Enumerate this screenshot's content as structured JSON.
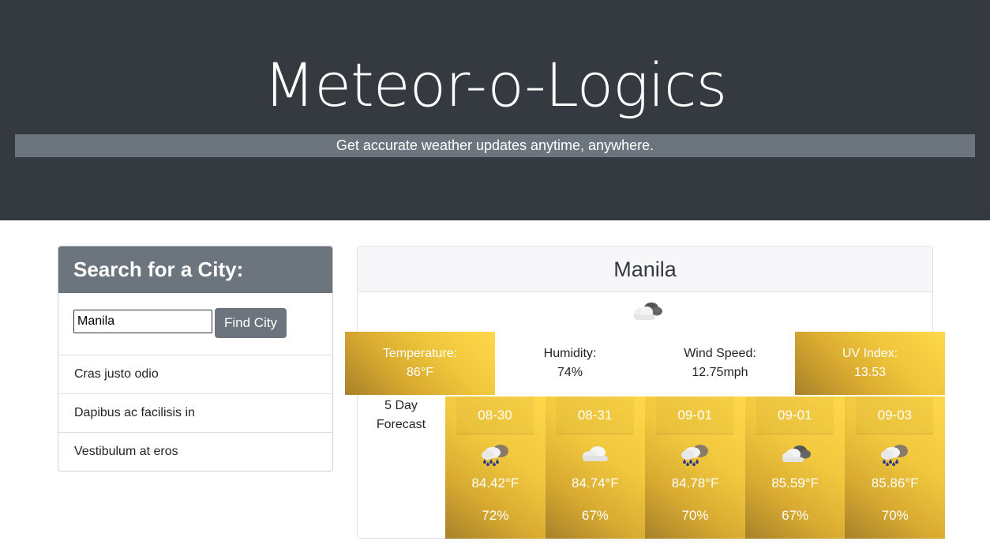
{
  "header": {
    "title": "Meteor-o-Logics",
    "tagline": "Get accurate weather updates anytime, anywhere."
  },
  "search": {
    "heading": "Search for a City:",
    "input_value": "Manila",
    "button_label": "Find City",
    "history": [
      "Cras justo odio",
      "Dapibus ac facilisis in",
      "Vestibulum at eros"
    ]
  },
  "current": {
    "city": "Manila",
    "icon": "cloudy-icon",
    "stats": [
      {
        "label": "Temperature:",
        "value": "86°F"
      },
      {
        "label": "Humidity:",
        "value": "74%"
      },
      {
        "label": "Wind Speed:",
        "value": "12.75mph"
      },
      {
        "label": "UV Index:",
        "value": "13.53"
      }
    ]
  },
  "forecast": {
    "label_line1": "5 Day",
    "label_line2": "Forecast",
    "days": [
      {
        "date": "08-30",
        "icon": "rain-icon",
        "temp": "84.42°F",
        "humidity": "72%"
      },
      {
        "date": "08-31",
        "icon": "cloud-icon",
        "temp": "84.74°F",
        "humidity": "67%"
      },
      {
        "date": "09-01",
        "icon": "rain-icon",
        "temp": "84.78°F",
        "humidity": "70%"
      },
      {
        "date": "09-01",
        "icon": "cloudy-icon",
        "temp": "85.59°F",
        "humidity": "67%"
      },
      {
        "date": "09-03",
        "icon": "rain-icon",
        "temp": "85.86°F",
        "humidity": "70%"
      }
    ]
  }
}
